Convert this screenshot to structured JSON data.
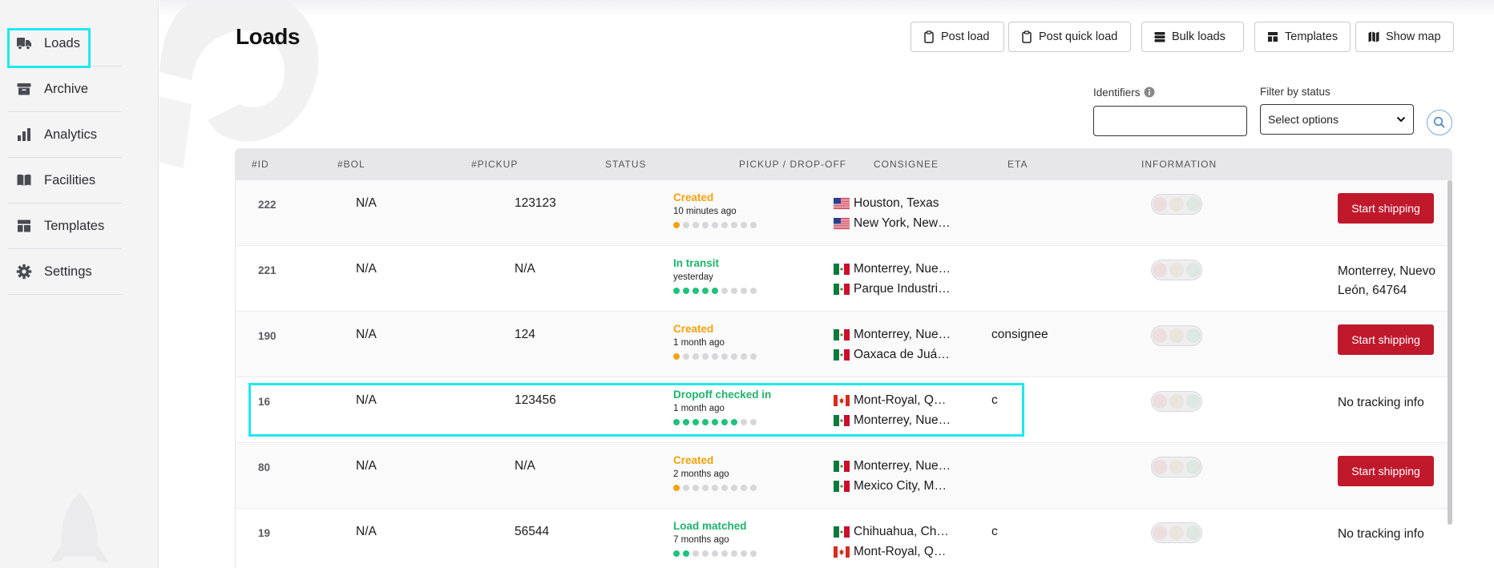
{
  "sidebar": {
    "items": [
      {
        "label": "Loads",
        "icon": "truck-icon",
        "active": true
      },
      {
        "label": "Archive",
        "icon": "archive-box-icon",
        "active": false
      },
      {
        "label": "Analytics",
        "icon": "bar-chart-icon",
        "active": false
      },
      {
        "label": "Facilities",
        "icon": "book-icon",
        "active": false
      },
      {
        "label": "Templates",
        "icon": "template-layout-icon",
        "active": false
      },
      {
        "label": "Settings",
        "icon": "gear-icon",
        "active": false
      }
    ]
  },
  "header": {
    "title": "Loads",
    "buttons": {
      "post_load": "Post load",
      "post_quick_load": "Post quick load",
      "bulk_loads": "Bulk loads",
      "templates": "Templates",
      "show_map": "Show map"
    }
  },
  "filters": {
    "identifiers_label": "Identifiers",
    "identifiers_value": "",
    "status_label": "Filter by status",
    "status_value": "Select options"
  },
  "table": {
    "columns": [
      "#ID",
      "#BOL",
      "#PICKUP",
      "STATUS",
      "PICKUP / DROP-OFF",
      "CONSIGNEE",
      "ETA",
      "INFORMATION"
    ],
    "rows": [
      {
        "id": "222",
        "bol": "N/A",
        "pickup": "123123",
        "status": "Created",
        "status_kind": "created",
        "time": "10 minutes ago",
        "progress": 1,
        "pickup_loc": "Houston, Texas",
        "pickup_flag": "us",
        "drop_loc": "New York, New…",
        "drop_flag": "us",
        "consignee": "",
        "info": "",
        "info_action": "Start shipping"
      },
      {
        "id": "221",
        "bol": "N/A",
        "pickup": "N/A",
        "status": "In transit",
        "status_kind": "green",
        "time": "yesterday",
        "progress": 5,
        "pickup_loc": "Monterrey, Nue…",
        "pickup_flag": "mx",
        "drop_loc": "Parque Industri…",
        "drop_flag": "mx",
        "consignee": "",
        "info": "Monterrey, Nuevo León, 64764",
        "info_action": ""
      },
      {
        "id": "190",
        "bol": "N/A",
        "pickup": "124",
        "status": "Created",
        "status_kind": "created",
        "time": "1 month ago",
        "progress": 1,
        "pickup_loc": "Monterrey, Nue…",
        "pickup_flag": "mx",
        "drop_loc": "Oaxaca de Juá…",
        "drop_flag": "mx",
        "consignee": "consignee",
        "info": "",
        "info_action": "Start shipping"
      },
      {
        "id": "16",
        "bol": "N/A",
        "pickup": "123456",
        "status": "Dropoff checked in",
        "status_kind": "green",
        "time": "1 month ago",
        "progress": 7,
        "pickup_loc": "Mont-Royal, Q…",
        "pickup_flag": "ca",
        "drop_loc": "Monterrey, Nue…",
        "drop_flag": "mx",
        "consignee": "c",
        "info": "No tracking info",
        "info_action": ""
      },
      {
        "id": "80",
        "bol": "N/A",
        "pickup": "N/A",
        "status": "Created",
        "status_kind": "created",
        "time": "2 months ago",
        "progress": 1,
        "pickup_loc": "Monterrey, Nue…",
        "pickup_flag": "mx",
        "drop_loc": "Mexico City, M…",
        "drop_flag": "mx",
        "consignee": "",
        "info": "",
        "info_action": "Start shipping"
      },
      {
        "id": "19",
        "bol": "N/A",
        "pickup": "56544",
        "status": "Load matched",
        "status_kind": "green",
        "time": "7 months ago",
        "progress": 2,
        "pickup_loc": "Chihuahua, Ch…",
        "pickup_flag": "mx",
        "drop_loc": "Mont-Royal, Q…",
        "drop_flag": "ca",
        "consignee": "c",
        "info": "No tracking info",
        "info_action": ""
      }
    ]
  },
  "colors": {
    "accent_red": "#c0192c",
    "created": "#f2a20d",
    "green": "#1fb36c",
    "highlight": "#1de9f0"
  }
}
